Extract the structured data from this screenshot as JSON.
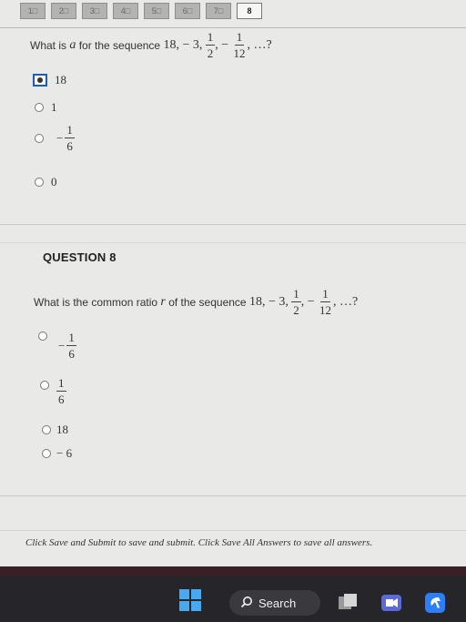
{
  "question_nav": [
    {
      "label": "1",
      "current": false
    },
    {
      "label": "2",
      "current": false
    },
    {
      "label": "3",
      "current": false
    },
    {
      "label": "4",
      "current": false
    },
    {
      "label": "5",
      "current": false
    },
    {
      "label": "6",
      "current": false
    },
    {
      "label": "7",
      "current": false
    },
    {
      "label": "8",
      "current": true
    }
  ],
  "question7": {
    "prompt_prefix": "What is",
    "variable": "a",
    "prompt_middle": "for the sequence",
    "seq_a": "18, − 3,",
    "frac1_num": "1",
    "frac1_den": "2",
    "seq_sep": ", −",
    "frac2_num": "1",
    "frac2_den": "12",
    "seq_end": ", …?",
    "options": {
      "o1": "18",
      "o2": "1",
      "o3_sign": "−",
      "o3_num": "1",
      "o3_den": "6",
      "o4": "0"
    },
    "selected": "18"
  },
  "question8": {
    "title": "QUESTION 8",
    "prompt_prefix": "What is the common ratio",
    "variable": "r",
    "prompt_middle": "of the sequence",
    "seq_a": "18, − 3,",
    "frac1_num": "1",
    "frac1_den": "2",
    "seq_sep": ", −",
    "frac2_num": "1",
    "frac2_den": "12",
    "seq_end": ", …?",
    "options": {
      "o1_sign": "−",
      "o1_num": "1",
      "o1_den": "6",
      "o2_num": "1",
      "o2_den": "6",
      "o3": "18",
      "o4": "− 6"
    }
  },
  "footer": {
    "note": "Click Save and Submit to save and submit. Click Save All Answers to save all answers."
  },
  "taskbar": {
    "search_label": "Search",
    "icons": [
      "windows-start-icon",
      "search-icon",
      "task-view-icon",
      "meet-video-icon",
      "app-icon"
    ],
    "colors": {
      "windows": "#49a9ee",
      "meet": "#5b6bd6",
      "app": "#2d7ff9"
    }
  }
}
